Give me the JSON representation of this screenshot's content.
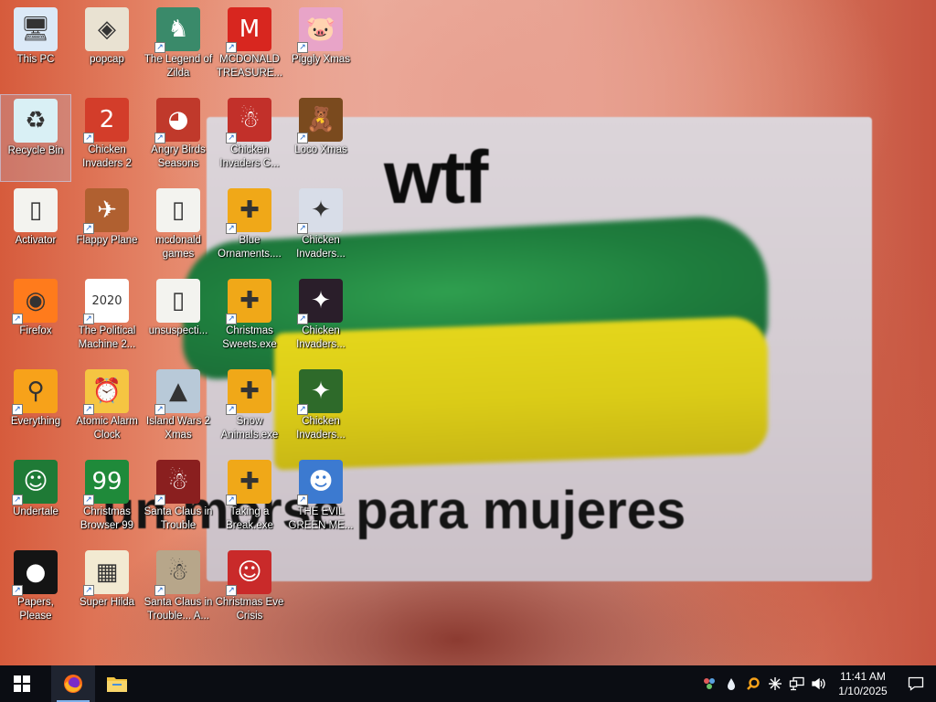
{
  "wallpaper": {
    "top_text": "wtf",
    "bottom_text": "un morse para mujeres"
  },
  "desktop_icons": [
    {
      "label": "This PC",
      "icon": "computer-icon",
      "glyph": "🖥",
      "bg": "#dbe9f7",
      "shortcut": false,
      "selected": false
    },
    {
      "label": "Recycle Bin",
      "icon": "recycle-bin-icon",
      "glyph": "♻",
      "bg": "#d9f0f5",
      "shortcut": false,
      "selected": true
    },
    {
      "label": "Activator",
      "icon": "folder-icon",
      "glyph": "▯",
      "bg": "#f3f3ef",
      "shortcut": false,
      "selected": false
    },
    {
      "label": "Firefox",
      "icon": "firefox-icon",
      "glyph": "◉",
      "bg": "#ff7b1c",
      "shortcut": true,
      "selected": false
    },
    {
      "label": "Everything",
      "icon": "everything-search-icon",
      "glyph": "⚲",
      "bg": "#f7a21a",
      "shortcut": true,
      "selected": false
    },
    {
      "label": "Undertale",
      "icon": "undertale-icon",
      "glyph": "☺",
      "bg": "#1f7a36",
      "shortcut": true,
      "selected": false
    },
    {
      "label": "Papers, Please",
      "icon": "papers-please-icon",
      "glyph": "●",
      "bg": "#141414",
      "shortcut": true,
      "selected": false
    },
    {
      "label": "popcap",
      "icon": "popcap-icon",
      "glyph": "◈",
      "bg": "#e9e2d2",
      "shortcut": false,
      "selected": false
    },
    {
      "label": "Chicken Invaders 2",
      "icon": "chicken-invaders-icon",
      "glyph": "2",
      "bg": "#d33d2a",
      "shortcut": true,
      "selected": false
    },
    {
      "label": "Flappy Plane",
      "icon": "flappy-plane-icon",
      "glyph": "✈",
      "bg": "#b06030",
      "shortcut": true,
      "selected": false
    },
    {
      "label": "The Political Machine 2...",
      "icon": "political-machine-icon",
      "glyph": "2020",
      "bg": "#ffffff",
      "shortcut": true,
      "selected": false
    },
    {
      "label": "Atomic Alarm Clock",
      "icon": "alarm-clock-icon",
      "glyph": "⏰",
      "bg": "#f5c542",
      "shortcut": true,
      "selected": false
    },
    {
      "label": "Christmas Browser 99",
      "icon": "christmas-tree-icon",
      "glyph": "99",
      "bg": "#1f8a3a",
      "shortcut": true,
      "selected": false
    },
    {
      "label": "Super Hilda",
      "icon": "super-hilda-icon",
      "glyph": "▦",
      "bg": "#f2ead2",
      "shortcut": true,
      "selected": false
    },
    {
      "label": "The Legend of Zilda",
      "icon": "zilda-icon",
      "glyph": "♞",
      "bg": "#3a8a6a",
      "shortcut": true,
      "selected": false
    },
    {
      "label": "Angry Birds Seasons",
      "icon": "angry-birds-icon",
      "glyph": "◕",
      "bg": "#c0392b",
      "shortcut": true,
      "selected": false
    },
    {
      "label": "mcdonald games",
      "icon": "folder-icon",
      "glyph": "▯",
      "bg": "#f3f3ef",
      "shortcut": false,
      "selected": false
    },
    {
      "label": "unsuspecti...",
      "icon": "file-icon",
      "glyph": "▯",
      "bg": "#f3f3ef",
      "shortcut": false,
      "selected": false
    },
    {
      "label": "Island Wars 2 Xmas",
      "icon": "island-wars-icon",
      "glyph": "▲",
      "bg": "#b8c9d8",
      "shortcut": true,
      "selected": false
    },
    {
      "label": "Santa Claus in Trouble",
      "icon": "santa-claus-icon",
      "glyph": "☃",
      "bg": "#8a1f1f",
      "shortcut": true,
      "selected": false
    },
    {
      "label": "Santa Claus in Trouble... A...",
      "icon": "santa-claus-icon",
      "glyph": "☃",
      "bg": "#b7a68a",
      "shortcut": true,
      "selected": false
    },
    {
      "label": "MCDONALD TREASURE...",
      "icon": "mcdonalds-icon",
      "glyph": "M",
      "bg": "#d8261f",
      "shortcut": true,
      "selected": false
    },
    {
      "label": "Chicken Invaders C...",
      "icon": "chicken-invaders-icon",
      "glyph": "☃",
      "bg": "#c2302a",
      "shortcut": true,
      "selected": false
    },
    {
      "label": "Blue Ornaments....",
      "icon": "puzzle-exe-icon",
      "glyph": "✚",
      "bg": "#f0a818",
      "shortcut": true,
      "selected": false
    },
    {
      "label": "Christmas Sweets.exe",
      "icon": "puzzle-exe-icon",
      "glyph": "✚",
      "bg": "#f0a818",
      "shortcut": true,
      "selected": false
    },
    {
      "label": "Snow Animals.exe",
      "icon": "puzzle-exe-icon",
      "glyph": "✚",
      "bg": "#f0a818",
      "shortcut": true,
      "selected": false
    },
    {
      "label": "Taking a Break.exe",
      "icon": "puzzle-exe-icon",
      "glyph": "✚",
      "bg": "#f0a818",
      "shortcut": true,
      "selected": false
    },
    {
      "label": "Christmas Eve Crisis",
      "icon": "santa-face-icon",
      "glyph": "☺",
      "bg": "#c92a2a",
      "shortcut": true,
      "selected": false
    },
    {
      "label": "Piggly Xmas",
      "icon": "piggly-icon",
      "glyph": "🐷",
      "bg": "#e8a4c8",
      "shortcut": true,
      "selected": false
    },
    {
      "label": "Loco Xmas",
      "icon": "teddy-bear-icon",
      "glyph": "🧸",
      "bg": "#7a4a1e",
      "shortcut": true,
      "selected": false
    },
    {
      "label": "Chicken Invaders...",
      "icon": "chicken-invaders-icon",
      "glyph": "✦",
      "bg": "#d8dde8",
      "shortcut": true,
      "selected": false
    },
    {
      "label": "Chicken Invaders...",
      "icon": "chicken-invaders-icon",
      "glyph": "✦",
      "bg": "#2a1e2a",
      "shortcut": true,
      "selected": false
    },
    {
      "label": "Chicken Invaders...",
      "icon": "chicken-invaders-icon",
      "glyph": "✦",
      "bg": "#2e6a2a",
      "shortcut": true,
      "selected": false
    },
    {
      "label": "THE EVIL GREEN ME...",
      "icon": "evil-green-icon",
      "glyph": "☻",
      "bg": "#3c7ad0",
      "shortcut": true,
      "selected": false
    }
  ],
  "taskbar": {
    "pinned": [
      {
        "name": "start",
        "icon": "windows-logo-icon"
      },
      {
        "name": "firefox",
        "icon": "firefox-icon",
        "active": true
      },
      {
        "name": "file-explorer",
        "icon": "folder-icon"
      }
    ],
    "tray_icons": [
      "people-icon",
      "drop-icon",
      "search-everything-icon",
      "snowflake-icon",
      "network-icon",
      "volume-icon"
    ],
    "time": "11:41 AM",
    "date": "1/10/2025"
  }
}
